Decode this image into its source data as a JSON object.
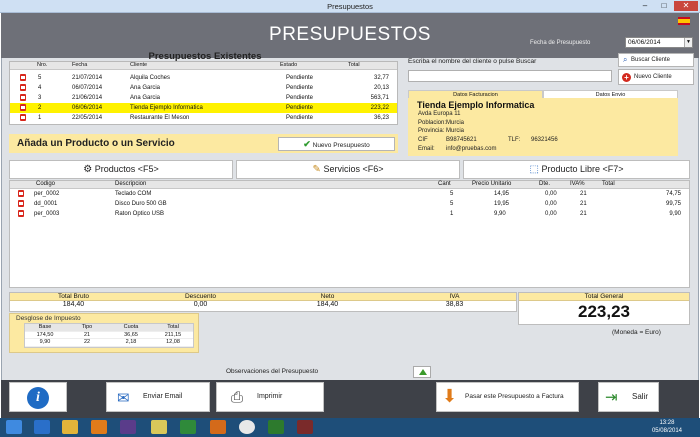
{
  "window": {
    "title": "Presupuestos",
    "minimize": "–",
    "maximize": "□",
    "close": "✕"
  },
  "header": {
    "title": "PRESUPUESTOS",
    "date_label": "Fecha de Presupuesto",
    "date_value": "06/06/2014",
    "flag": "spain-flag-icon"
  },
  "budgets": {
    "title": "Presupuestos Existentes",
    "columns": [
      "Nro.",
      "Fecha",
      "Cliente",
      "Estado",
      "Total"
    ],
    "rows": [
      {
        "nro": "5",
        "fecha": "21/07/2014",
        "cliente": "Alquila Coches",
        "estado": "Pendiente",
        "total": "32,77"
      },
      {
        "nro": "4",
        "fecha": "06/07/2014",
        "cliente": "Ana Garcia",
        "estado": "Pendiente",
        "total": "20,13"
      },
      {
        "nro": "3",
        "fecha": "21/06/2014",
        "cliente": "Ana Garcia",
        "estado": "Pendiente",
        "total": "563,71"
      },
      {
        "nro": "2",
        "fecha": "06/06/2014",
        "cliente": "Tienda Ejemplo Informatica",
        "estado": "Pendiente",
        "total": "223,22"
      },
      {
        "nro": "1",
        "fecha": "22/05/2014",
        "cliente": "Restaurante El Meson",
        "estado": "Pendiente",
        "total": "36,23"
      }
    ]
  },
  "client_search": {
    "hint": "Escriba el nombre del cliente o pulse Buscar",
    "value": "",
    "buscar": "Buscar Cliente",
    "nuevo": "Nuevo Cliente"
  },
  "client": {
    "tab_facturacion": "Datos Facturacion",
    "tab_envio": "Datos Envio",
    "name": "Tienda Ejemplo Informatica",
    "address": "Avda Europa 11",
    "poblacion_label": "Poblacion:",
    "poblacion": "Murcia",
    "provincia_label": "Provincia:",
    "provincia": "Murcia",
    "cif_label": "CIF",
    "cif": "B98745621",
    "tlf_label": "TLF:",
    "tlf": "96321456",
    "email_label": "Email:",
    "email": "info@pruebas.com"
  },
  "add": {
    "title": "Añada un Producto o un Servicio",
    "nuevo_presupuesto": "Nuevo Presupuesto"
  },
  "tabs": {
    "productos": "Productos <F5>",
    "servicios": "Servicios <F6>",
    "libre": "Producto Libre <F7>"
  },
  "lines": {
    "columns": [
      "Codigo",
      "Descripcion",
      "Cant",
      "Precio Unitario",
      "Dte.",
      "IVA%",
      "Total"
    ],
    "rows": [
      {
        "codigo": "per_0002",
        "descripcion": "Teclado COM",
        "cant": "5",
        "precio": "14,95",
        "dte": "0,00",
        "iva": "21",
        "total": "74,75"
      },
      {
        "codigo": "dd_0001",
        "descripcion": "Disco Duro 500 GB",
        "cant": "5",
        "precio": "19,95",
        "dte": "0,00",
        "iva": "21",
        "total": "99,75"
      },
      {
        "codigo": "per_0003",
        "descripcion": "Raton Optico USB",
        "cant": "1",
        "precio": "9,90",
        "dte": "0,00",
        "iva": "21",
        "total": "9,90"
      }
    ]
  },
  "totals": {
    "bruto_label": "Total Bruto",
    "bruto": "184,40",
    "descuento_label": "Descuento",
    "descuento": "0,00",
    "neto_label": "Neto",
    "neto": "184,40",
    "iva_label": "IVA",
    "iva": "38,83",
    "general_label": "Total General",
    "general": "223,23",
    "moneda": "(Moneda = Euro)"
  },
  "desglose": {
    "title": "Desglose de Impuesto",
    "columns": [
      "Base",
      "Tipo",
      "Cuota",
      "Total"
    ],
    "rows": [
      {
        "base": "174,50",
        "tipo": "21",
        "cuota": "36,65",
        "total": "211,15"
      },
      {
        "base": "9,90",
        "tipo": "22",
        "cuota": "2,18",
        "total": "12,08"
      }
    ]
  },
  "observaciones": {
    "label": "Observaciones del Presupuesto"
  },
  "footer": {
    "enviar": "Enviar Email",
    "imprimir": "Imprimir",
    "factura": "Pasar este Presupuesto a Factura",
    "salir": "Salir"
  },
  "taskbar": {
    "time": "13:28",
    "date": "05/08/2014"
  },
  "colors": {
    "header": "#6e7078",
    "highlight": "#fff200",
    "panel": "#fce9a1",
    "footer": "#3e4148",
    "taskbar": "#1e4e79"
  }
}
